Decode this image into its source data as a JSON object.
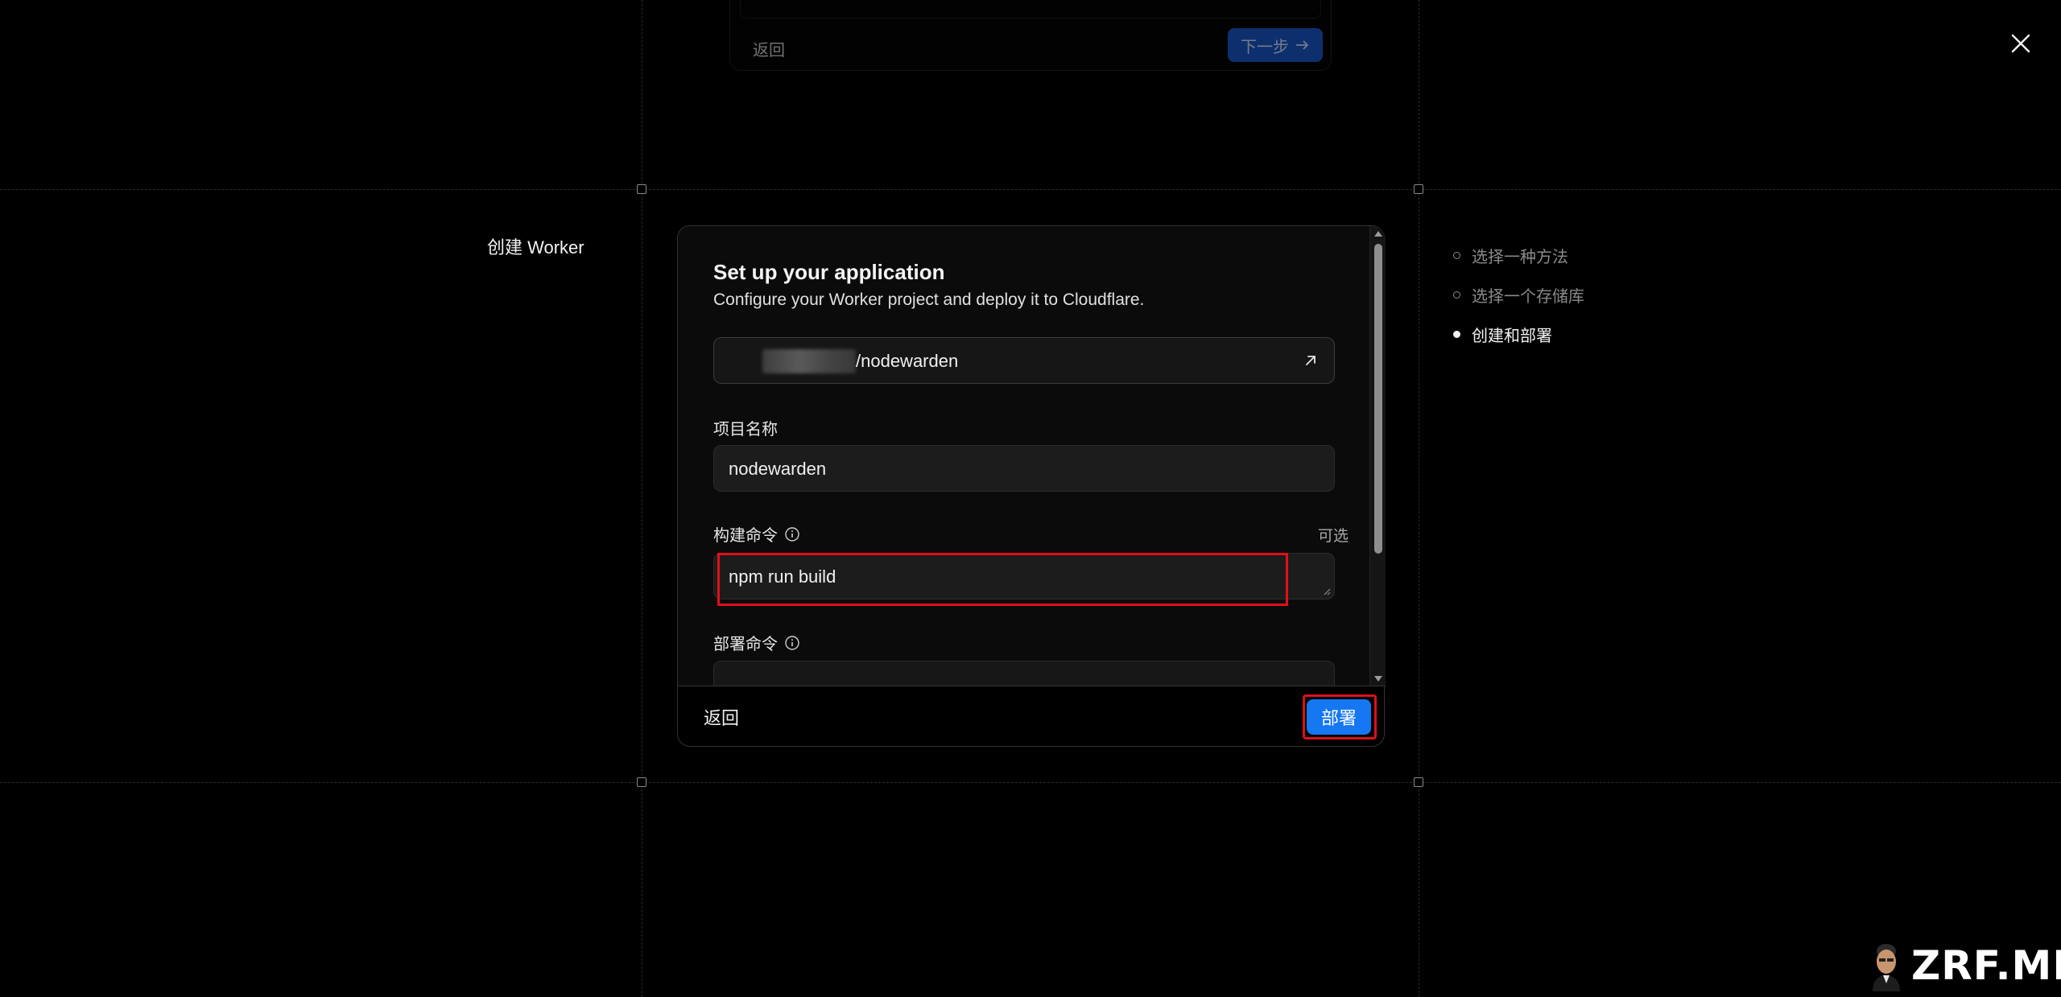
{
  "previous_step": {
    "back_label": "返回",
    "next_label": "下一步",
    "next_icon": "arrow-right-icon"
  },
  "close_icon": "close-icon",
  "page_title": "创建 Worker",
  "form": {
    "heading": "Set up your application",
    "subheading": "Configure your Worker project and deploy it to Cloudflare.",
    "repository": {
      "value": "/nodewarden",
      "link_icon": "external-link-icon"
    },
    "project_name": {
      "label": "项目名称",
      "value": "nodewarden"
    },
    "build_command": {
      "label": "构建命令",
      "optional": "可选",
      "value": "npm run build",
      "info_icon": "info-icon"
    },
    "deploy_command": {
      "label": "部署命令",
      "info_icon": "info-icon"
    }
  },
  "footer": {
    "back_label": "返回",
    "deploy_label": "部署"
  },
  "steps": [
    {
      "label": "选择一种方法",
      "state": "done"
    },
    {
      "label": "选择一个存储库",
      "state": "done"
    },
    {
      "label": "创建和部署",
      "state": "active"
    }
  ],
  "colors": {
    "accent": "#1677f2",
    "highlight": "#e0101a",
    "background": "#000000"
  },
  "watermark": "ZRF.ME"
}
